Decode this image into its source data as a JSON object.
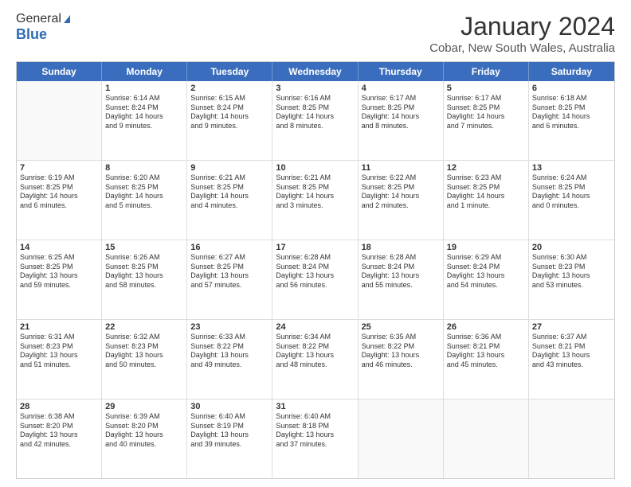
{
  "logo": {
    "line1": "General",
    "line2": "Blue"
  },
  "title": "January 2024",
  "location": "Cobar, New South Wales, Australia",
  "header_days": [
    "Sunday",
    "Monday",
    "Tuesday",
    "Wednesday",
    "Thursday",
    "Friday",
    "Saturday"
  ],
  "weeks": [
    [
      {
        "day": "",
        "sunrise": "",
        "sunset": "",
        "daylight": ""
      },
      {
        "day": "1",
        "sunrise": "Sunrise: 6:14 AM",
        "sunset": "Sunset: 8:24 PM",
        "daylight": "Daylight: 14 hours and 9 minutes."
      },
      {
        "day": "2",
        "sunrise": "Sunrise: 6:15 AM",
        "sunset": "Sunset: 8:24 PM",
        "daylight": "Daylight: 14 hours and 9 minutes."
      },
      {
        "day": "3",
        "sunrise": "Sunrise: 6:16 AM",
        "sunset": "Sunset: 8:25 PM",
        "daylight": "Daylight: 14 hours and 8 minutes."
      },
      {
        "day": "4",
        "sunrise": "Sunrise: 6:17 AM",
        "sunset": "Sunset: 8:25 PM",
        "daylight": "Daylight: 14 hours and 8 minutes."
      },
      {
        "day": "5",
        "sunrise": "Sunrise: 6:17 AM",
        "sunset": "Sunset: 8:25 PM",
        "daylight": "Daylight: 14 hours and 7 minutes."
      },
      {
        "day": "6",
        "sunrise": "Sunrise: 6:18 AM",
        "sunset": "Sunset: 8:25 PM",
        "daylight": "Daylight: 14 hours and 6 minutes."
      }
    ],
    [
      {
        "day": "7",
        "sunrise": "Sunrise: 6:19 AM",
        "sunset": "Sunset: 8:25 PM",
        "daylight": "Daylight: 14 hours and 6 minutes."
      },
      {
        "day": "8",
        "sunrise": "Sunrise: 6:20 AM",
        "sunset": "Sunset: 8:25 PM",
        "daylight": "Daylight: 14 hours and 5 minutes."
      },
      {
        "day": "9",
        "sunrise": "Sunrise: 6:21 AM",
        "sunset": "Sunset: 8:25 PM",
        "daylight": "Daylight: 14 hours and 4 minutes."
      },
      {
        "day": "10",
        "sunrise": "Sunrise: 6:21 AM",
        "sunset": "Sunset: 8:25 PM",
        "daylight": "Daylight: 14 hours and 3 minutes."
      },
      {
        "day": "11",
        "sunrise": "Sunrise: 6:22 AM",
        "sunset": "Sunset: 8:25 PM",
        "daylight": "Daylight: 14 hours and 2 minutes."
      },
      {
        "day": "12",
        "sunrise": "Sunrise: 6:23 AM",
        "sunset": "Sunset: 8:25 PM",
        "daylight": "Daylight: 14 hours and 1 minute."
      },
      {
        "day": "13",
        "sunrise": "Sunrise: 6:24 AM",
        "sunset": "Sunset: 8:25 PM",
        "daylight": "Daylight: 14 hours and 0 minutes."
      }
    ],
    [
      {
        "day": "14",
        "sunrise": "Sunrise: 6:25 AM",
        "sunset": "Sunset: 8:25 PM",
        "daylight": "Daylight: 13 hours and 59 minutes."
      },
      {
        "day": "15",
        "sunrise": "Sunrise: 6:26 AM",
        "sunset": "Sunset: 8:25 PM",
        "daylight": "Daylight: 13 hours and 58 minutes."
      },
      {
        "day": "16",
        "sunrise": "Sunrise: 6:27 AM",
        "sunset": "Sunset: 8:25 PM",
        "daylight": "Daylight: 13 hours and 57 minutes."
      },
      {
        "day": "17",
        "sunrise": "Sunrise: 6:28 AM",
        "sunset": "Sunset: 8:24 PM",
        "daylight": "Daylight: 13 hours and 56 minutes."
      },
      {
        "day": "18",
        "sunrise": "Sunrise: 6:28 AM",
        "sunset": "Sunset: 8:24 PM",
        "daylight": "Daylight: 13 hours and 55 minutes."
      },
      {
        "day": "19",
        "sunrise": "Sunrise: 6:29 AM",
        "sunset": "Sunset: 8:24 PM",
        "daylight": "Daylight: 13 hours and 54 minutes."
      },
      {
        "day": "20",
        "sunrise": "Sunrise: 6:30 AM",
        "sunset": "Sunset: 8:23 PM",
        "daylight": "Daylight: 13 hours and 53 minutes."
      }
    ],
    [
      {
        "day": "21",
        "sunrise": "Sunrise: 6:31 AM",
        "sunset": "Sunset: 8:23 PM",
        "daylight": "Daylight: 13 hours and 51 minutes."
      },
      {
        "day": "22",
        "sunrise": "Sunrise: 6:32 AM",
        "sunset": "Sunset: 8:23 PM",
        "daylight": "Daylight: 13 hours and 50 minutes."
      },
      {
        "day": "23",
        "sunrise": "Sunrise: 6:33 AM",
        "sunset": "Sunset: 8:22 PM",
        "daylight": "Daylight: 13 hours and 49 minutes."
      },
      {
        "day": "24",
        "sunrise": "Sunrise: 6:34 AM",
        "sunset": "Sunset: 8:22 PM",
        "daylight": "Daylight: 13 hours and 48 minutes."
      },
      {
        "day": "25",
        "sunrise": "Sunrise: 6:35 AM",
        "sunset": "Sunset: 8:22 PM",
        "daylight": "Daylight: 13 hours and 46 minutes."
      },
      {
        "day": "26",
        "sunrise": "Sunrise: 6:36 AM",
        "sunset": "Sunset: 8:21 PM",
        "daylight": "Daylight: 13 hours and 45 minutes."
      },
      {
        "day": "27",
        "sunrise": "Sunrise: 6:37 AM",
        "sunset": "Sunset: 8:21 PM",
        "daylight": "Daylight: 13 hours and 43 minutes."
      }
    ],
    [
      {
        "day": "28",
        "sunrise": "Sunrise: 6:38 AM",
        "sunset": "Sunset: 8:20 PM",
        "daylight": "Daylight: 13 hours and 42 minutes."
      },
      {
        "day": "29",
        "sunrise": "Sunrise: 6:39 AM",
        "sunset": "Sunset: 8:20 PM",
        "daylight": "Daylight: 13 hours and 40 minutes."
      },
      {
        "day": "30",
        "sunrise": "Sunrise: 6:40 AM",
        "sunset": "Sunset: 8:19 PM",
        "daylight": "Daylight: 13 hours and 39 minutes."
      },
      {
        "day": "31",
        "sunrise": "Sunrise: 6:40 AM",
        "sunset": "Sunset: 8:18 PM",
        "daylight": "Daylight: 13 hours and 37 minutes."
      },
      {
        "day": "",
        "sunrise": "",
        "sunset": "",
        "daylight": ""
      },
      {
        "day": "",
        "sunrise": "",
        "sunset": "",
        "daylight": ""
      },
      {
        "day": "",
        "sunrise": "",
        "sunset": "",
        "daylight": ""
      }
    ]
  ]
}
